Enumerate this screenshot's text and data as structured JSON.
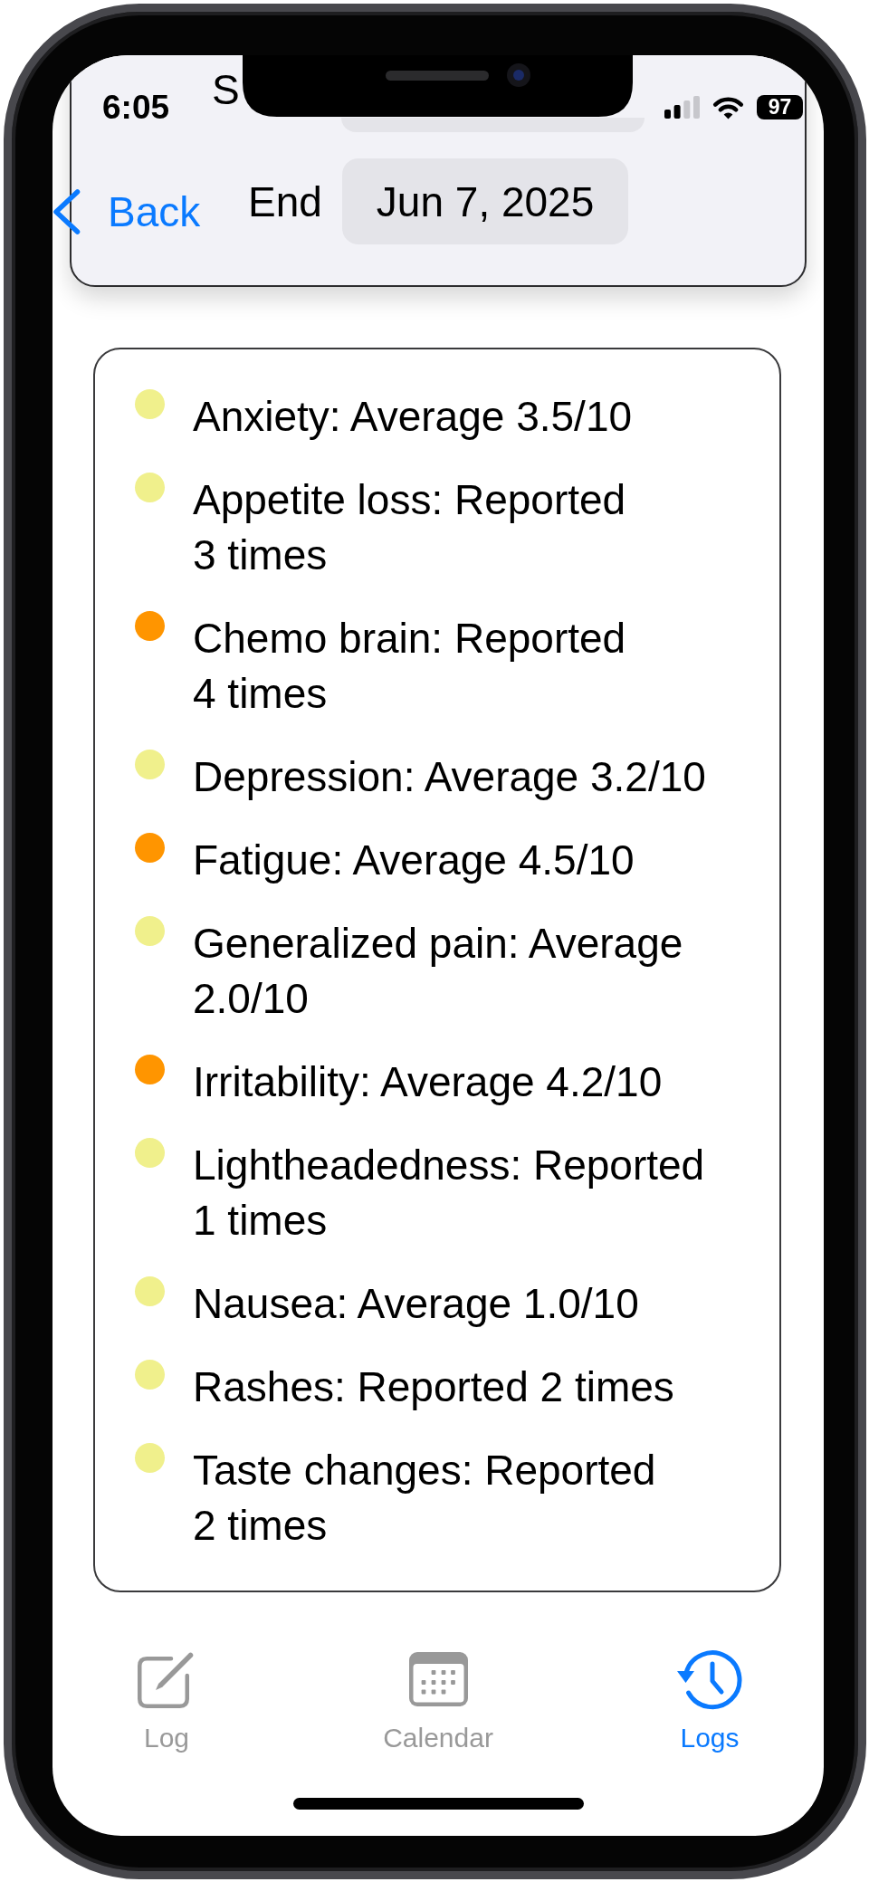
{
  "status_bar": {
    "time": "6:05",
    "battery": "97"
  },
  "navigation": {
    "back_button": "Back"
  },
  "date_range": {
    "start": {
      "label": "S"
    },
    "end": {
      "label": "End",
      "value": "Jun 7, 2025"
    }
  },
  "symptoms": [
    {
      "text": "Anxiety: Average 3.5/10",
      "color": "#f0f08c"
    },
    {
      "text": "Appetite loss: Reported 3 times",
      "color": "#f0f08c"
    },
    {
      "text": "Chemo brain: Reported 4 times",
      "color": "#ff9500"
    },
    {
      "text": "Depression: Average 3.2/10",
      "color": "#f0f08c"
    },
    {
      "text": "Fatigue: Average 4.5/10",
      "color": "#ff9500"
    },
    {
      "text": "Generalized pain: Average 2.0/10",
      "color": "#f0f08c"
    },
    {
      "text": "Irritability: Average 4.2/10",
      "color": "#ff9500"
    },
    {
      "text": "Lightheadedness: Reported 1 times",
      "color": "#f0f08c"
    },
    {
      "text": "Nausea: Average 1.0/10",
      "color": "#f0f08c"
    },
    {
      "text": "Rashes: Reported 2 times",
      "color": "#f0f08c"
    },
    {
      "text": "Taste changes: Reported 2 times",
      "color": "#f0f08c"
    }
  ],
  "tab_bar": {
    "tabs": [
      {
        "label": "Log",
        "kind": "compose",
        "selected": false
      },
      {
        "label": "Calendar",
        "kind": "calendar",
        "selected": false
      },
      {
        "label": "Logs",
        "kind": "history",
        "selected": true
      }
    ]
  }
}
